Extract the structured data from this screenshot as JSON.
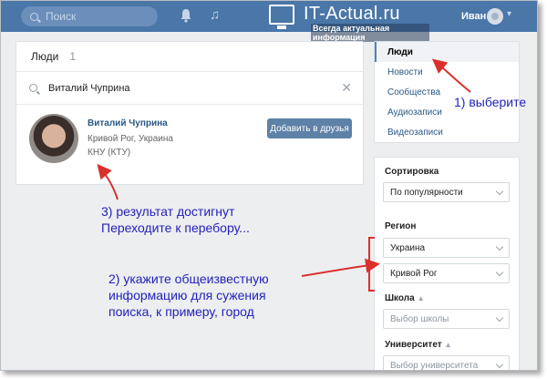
{
  "header": {
    "search_placeholder": "Поиск",
    "notifications_icon": "bell-icon",
    "music_icon": "music-icon",
    "logo_title": "IT-Actual.ru",
    "logo_tagline": "Всегда актуальная информация",
    "user_name": "Иван"
  },
  "main": {
    "section_title": "Люди",
    "result_count": "1",
    "query": "Виталий Чуприна",
    "result": {
      "name": "Виталий Чуприна",
      "location": "Кривой Рог, Украина",
      "university": "КНУ (КТУ)",
      "add_button": "Добавить в друзья"
    }
  },
  "nav": {
    "items": [
      {
        "label": "Люди",
        "active": true
      },
      {
        "label": "Новости",
        "active": false
      },
      {
        "label": "Сообщества",
        "active": false
      },
      {
        "label": "Аудиозаписи",
        "active": false
      },
      {
        "label": "Видеозаписи",
        "active": false
      }
    ]
  },
  "filters": {
    "sort_label": "Сортировка",
    "sort_value": "По популярности",
    "region_label": "Регион",
    "country_value": "Украина",
    "city_value": "Кривой Рог",
    "school_label": "Школа",
    "school_placeholder": "Выбор школы",
    "university_label": "Университет",
    "university_placeholder": "Выбор университета"
  },
  "annotations": {
    "step1": "1) выберите",
    "step2_line1": "2) укажите общеизвестную",
    "step2_line2": "информацию для сужения",
    "step2_line3": "поиска, к примеру, город",
    "step3_line1": "3) результат достигнут",
    "step3_line2": "Переходите к перебору...",
    "arrow_color": "#d9302c",
    "text_color": "#2222bb"
  },
  "colors": {
    "header_bg": "#4a76a8",
    "link": "#2a5885",
    "button_bg": "#5e81a8",
    "page_bg": "#edeef0"
  }
}
